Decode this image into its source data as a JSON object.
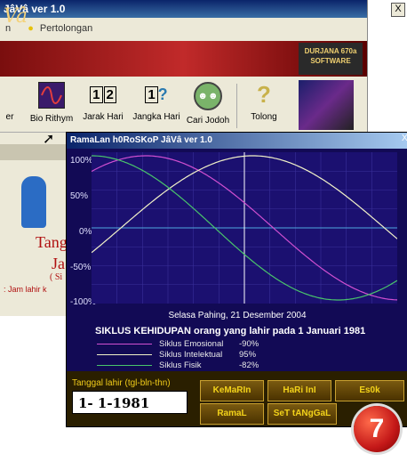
{
  "back_window": {
    "title": "JâVâ ver 1.0",
    "close": "X",
    "menu_left": "n",
    "menu_help": "Pertolongan",
    "banner_text": "Vâ",
    "logo": "DURJANA 670a SOFTWARE",
    "toolbar": [
      {
        "label": "er",
        "icon": ""
      },
      {
        "label": "Bio Rithym",
        "icon": "wave-icon"
      },
      {
        "label": "Jarak Hari",
        "icon": "1-2"
      },
      {
        "label": "Jangka Hari",
        "icon": "1?"
      },
      {
        "label": "Cari Jodoh",
        "icon": "couple-icon"
      },
      {
        "label": "Tolong",
        "icon": "question-icon"
      }
    ],
    "side_text_1": "Tang",
    "side_text_2": "Ja",
    "side_text_3": "( Si",
    "side_text_4": ": Jam lahir k"
  },
  "dialog": {
    "title": "RamaLan h0RoSKoP JâVâ ver 1.0",
    "close": "X",
    "y_labels": [
      "100%",
      "50%",
      "0%",
      "-50%",
      "-100%"
    ],
    "date_line": "Selasa Pahing, 21 Desember 2004",
    "siklus_title": "SIKLUS KEHIDUPAN orang yang lahir pada 1 Januari 1981",
    "legend": [
      {
        "name": "Siklus Emosional",
        "pct": "-90%",
        "color": "#d04fd0"
      },
      {
        "name": "Siklus Intelektual",
        "pct": "95%",
        "color": "#f2f2c8"
      },
      {
        "name": "Siklus Fisik",
        "pct": "-82%",
        "color": "#49c46b"
      }
    ],
    "dob_label": "Tanggal lahir (tgl-bln-thn)",
    "dob_value": "1- 1-1981",
    "buttons": {
      "kemarin": "KeMaRIn",
      "hari_ini": "HaRi InI",
      "esok": "Es0k",
      "ramal": "RamaL",
      "set_tanggal": "SeT tANgGaL"
    }
  },
  "badge": "7",
  "colors": {
    "plot_bg": "#1b1070",
    "grid": "#3a2f9a",
    "accent_gold": "#f2d21a"
  }
}
